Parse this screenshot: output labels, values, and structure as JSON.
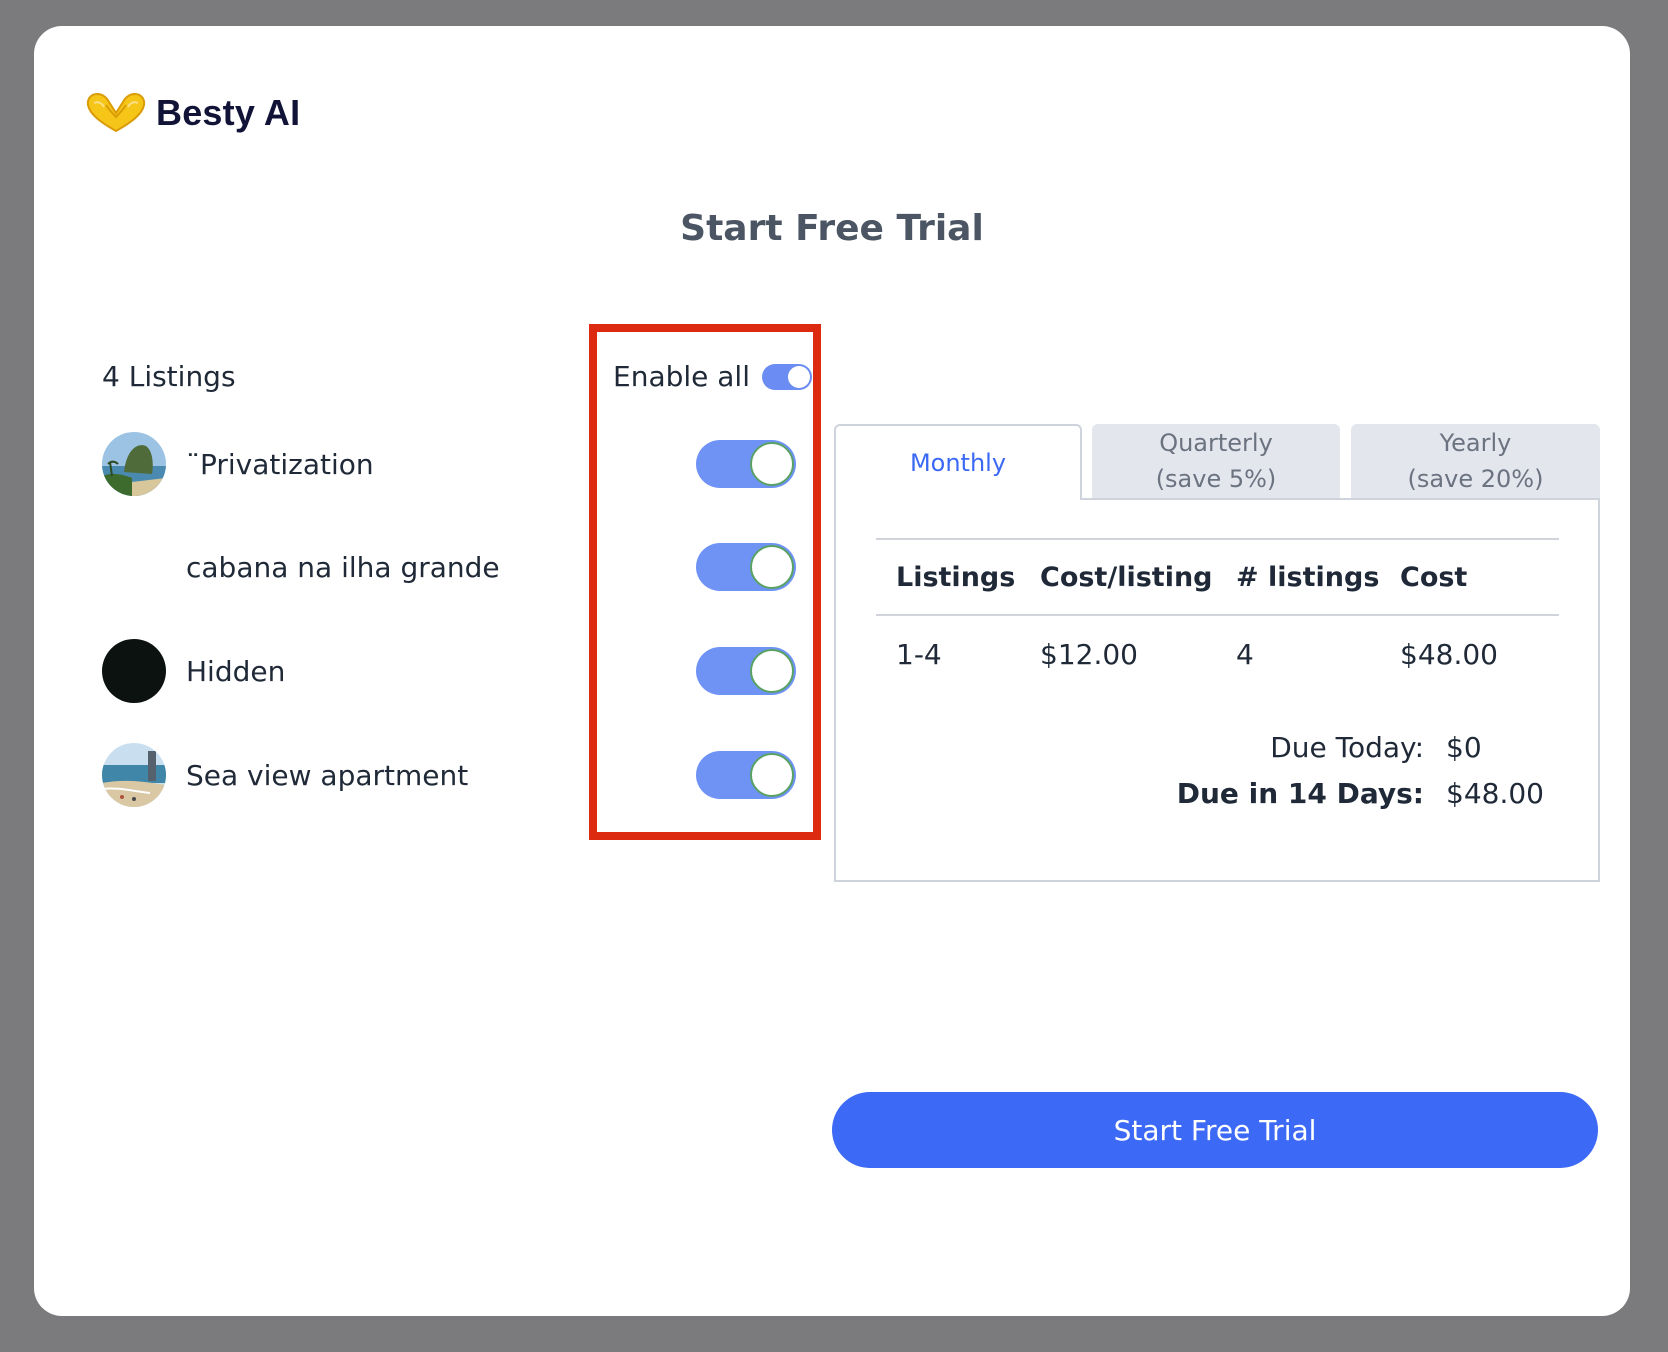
{
  "brand": {
    "name": "Besty AI",
    "icon": "heart-hands-icon",
    "icon_color": "#f5c518"
  },
  "page": {
    "title": "Start Free Trial"
  },
  "listings": {
    "count_label": "4 Listings",
    "enable_all_label": "Enable all",
    "enable_all_on": true,
    "items": [
      {
        "name": "¨Privatization",
        "avatar": "island-photo",
        "enabled": true
      },
      {
        "name": "cabana na ilha grande",
        "avatar": "none",
        "enabled": true
      },
      {
        "name": "Hidden",
        "avatar": "dark-photo",
        "enabled": true
      },
      {
        "name": "Sea view apartment",
        "avatar": "beach-photo",
        "enabled": true
      }
    ]
  },
  "pricing": {
    "tabs": [
      {
        "line1": "Monthly",
        "line2": "",
        "active": true
      },
      {
        "line1": "Quarterly",
        "line2": "(save 5%)",
        "active": false
      },
      {
        "line1": "Yearly",
        "line2": "(save 20%)",
        "active": false
      }
    ],
    "table": {
      "headers": [
        "Listings",
        "Cost/listing",
        "# listings",
        "Cost"
      ],
      "rows": [
        [
          "1-4",
          "$12.00",
          "4",
          "$48.00"
        ]
      ]
    },
    "due_today_label": "Due Today:",
    "due_today_value": "$0",
    "due_later_label": "Due in 14 Days:",
    "due_later_value": "$48.00"
  },
  "cta": {
    "label": "Start Free Trial"
  },
  "colors": {
    "accent": "#3c69f6",
    "toggle_on": "#6e93f5",
    "highlight": "#dc2a10",
    "backdrop": "#7b7b7d"
  }
}
